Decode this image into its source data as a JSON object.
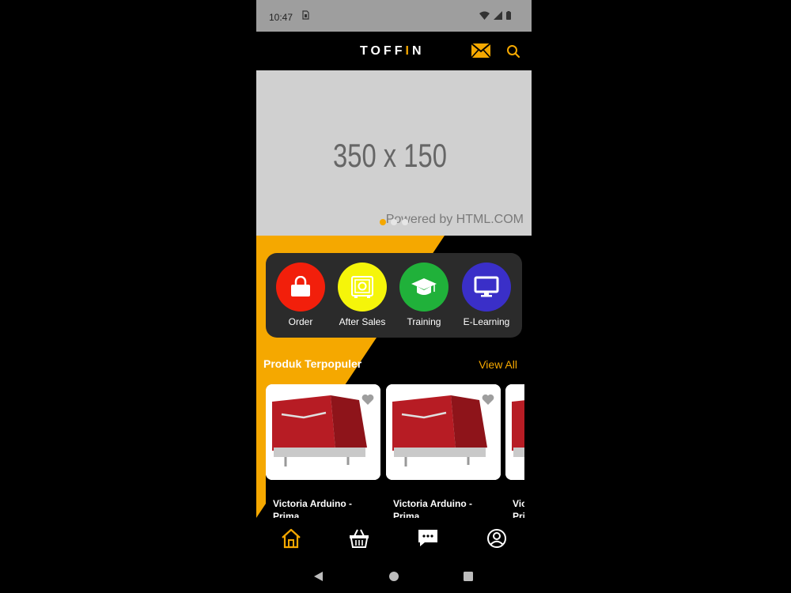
{
  "status_bar": {
    "time": "10:47",
    "sim_icon": "sim-card-icon",
    "icons": [
      "wifi-icon",
      "signal-icon",
      "battery-icon"
    ]
  },
  "app_bar": {
    "logo_left": "TOFF",
    "logo_accent": "I",
    "logo_right": "N",
    "actions": [
      "mail-icon",
      "search-icon"
    ]
  },
  "banner": {
    "size_text": "350 x 150",
    "credit": "Powered by HTML.COM",
    "active_slide": 1,
    "slides": 3
  },
  "services": [
    {
      "label": "Order",
      "icon": "shopping-bag-icon",
      "color": "#f21f0b"
    },
    {
      "label": "After Sales",
      "icon": "safe-icon",
      "color": "#f5f50a"
    },
    {
      "label": "Training",
      "icon": "graduation-cap-icon",
      "color": "#20b13a"
    },
    {
      "label": "E-Learning",
      "icon": "monitor-icon",
      "color": "#3a2fc8"
    }
  ],
  "popular": {
    "title": "Produk Terpopuler",
    "view_all": "View All",
    "products": [
      {
        "name": "Victoria Arduino - Prima"
      },
      {
        "name": "Victoria Arduino - Prima"
      },
      {
        "name": "Victoria Arduino - Prima"
      }
    ]
  },
  "bottom_nav": [
    {
      "name": "home",
      "icon": "home-icon",
      "active": true
    },
    {
      "name": "basket",
      "icon": "basket-icon",
      "active": false
    },
    {
      "name": "chat",
      "icon": "chat-icon",
      "active": false
    },
    {
      "name": "profile",
      "icon": "profile-icon",
      "active": false
    }
  ],
  "colors": {
    "accent": "#f5a800",
    "card_bg": "#2b2b2b"
  }
}
